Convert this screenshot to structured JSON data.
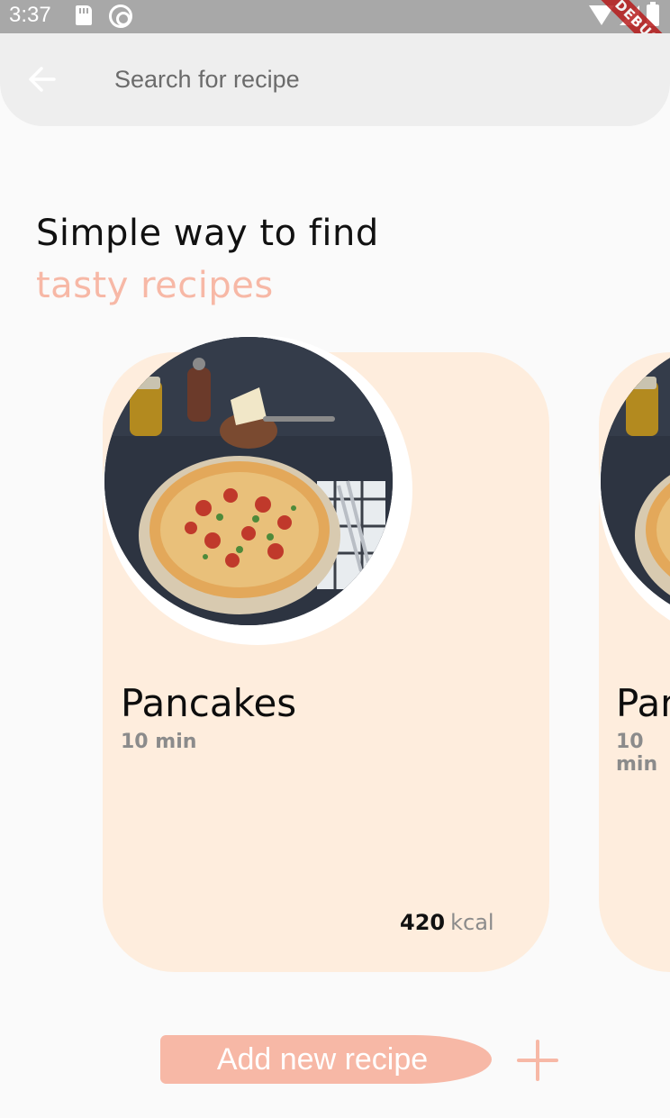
{
  "status_bar": {
    "time": "3:37",
    "icons": [
      "sd-card-icon",
      "at-sign-icon",
      "wifi-icon",
      "signal-icon",
      "battery-icon"
    ]
  },
  "debug_banner": "DEBUG",
  "search": {
    "placeholder": "Search for recipe",
    "back_icon": "arrow-left-icon"
  },
  "heading": {
    "line1": "Simple way to find",
    "line2": "tasty recipes"
  },
  "recipes": [
    {
      "title": "Pancakes",
      "time": "10 min",
      "kcal_value": "420",
      "kcal_unit": "kcal",
      "image": "pizza-photo"
    },
    {
      "title": "Pancakes",
      "time": "10 min",
      "image": "pizza-photo"
    }
  ],
  "actions": {
    "add_label": "Add new recipe",
    "plus_icon": "plus-icon"
  },
  "colors": {
    "accent": "#f7b8a6",
    "card_background": "#feeddd",
    "header_background": "#eeeeee",
    "status_bar": "#a8a8a8"
  }
}
